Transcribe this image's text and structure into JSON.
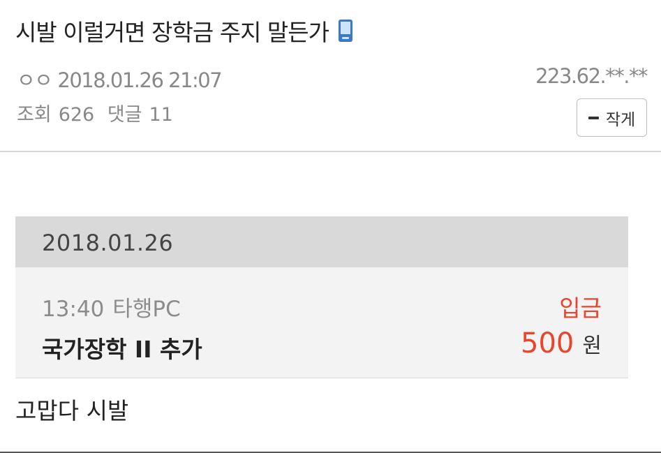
{
  "post": {
    "title": "시발 이럴거면 장학금 주지 말든가",
    "author": "ㅇㅇ",
    "datetime": "2018.01.26 21:07",
    "ip": "223.62.**.**",
    "views_label": "조회",
    "views": "626",
    "comments_label": "댓글",
    "comments": "11",
    "shrink_label": "작게",
    "body_text": "고맙다 시발"
  },
  "bank_card": {
    "date": "2018.01.26",
    "time": "13:40",
    "source": "타행PC",
    "type": "입금",
    "description": "국가장학 II 추가",
    "amount": "500",
    "currency": "원",
    "accent_color": "#e8452c"
  },
  "icons": {
    "title_icon": "mobile-phone-icon",
    "shrink_icon": "minus-icon"
  }
}
